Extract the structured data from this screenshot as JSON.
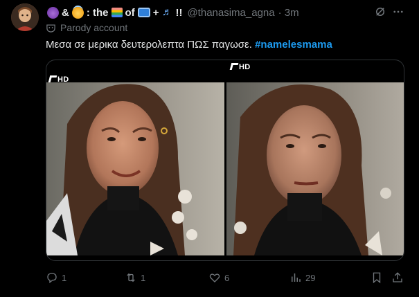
{
  "author": {
    "display_name_parts": {
      "amp": "&",
      "colon": ": the",
      "of": "of",
      "plus": "+",
      "bang": "!!"
    },
    "emojis": [
      "smiling-devil",
      "smiling-angel",
      "book",
      "television",
      "musical-notes"
    ],
    "handle": "@thanasima_agna",
    "timestamp": "· 3m",
    "label": "Parody account"
  },
  "tweet": {
    "text": "Μεσα σε μερικα δευτερολεπτα ΠΩΣ παγωσε.",
    "hashtag": "#namelesmama"
  },
  "media": {
    "images": [
      {
        "description": "woman-smiling",
        "badge": "HD"
      },
      {
        "description": "woman-frozen-expression",
        "badge": "HD"
      }
    ]
  },
  "actions": {
    "replies": "1",
    "reposts": "1",
    "likes": "6",
    "views": "29"
  },
  "colors": {
    "background": "#000000",
    "text": "#e7e9ea",
    "muted": "#71767b",
    "link": "#1d9bf0",
    "border": "#2f3336"
  },
  "icons": [
    "grok-icon",
    "more-icon",
    "mask-icon",
    "reply-icon",
    "repost-icon",
    "like-icon",
    "views-icon",
    "bookmark-icon",
    "share-icon"
  ]
}
